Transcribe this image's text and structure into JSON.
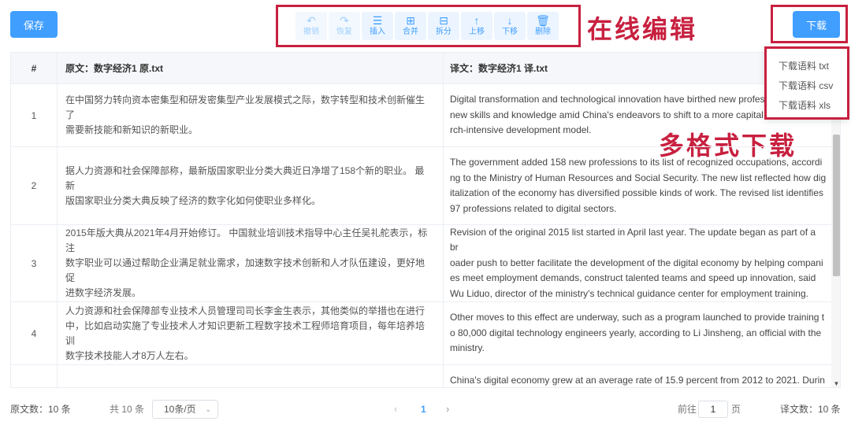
{
  "toolbar": {
    "save_label": "保存",
    "tools": [
      {
        "icon": "undo-icon",
        "glyph": "↶",
        "label": "撤销",
        "enabled": false
      },
      {
        "icon": "redo-icon",
        "glyph": "↷",
        "label": "恢复",
        "enabled": false
      },
      {
        "icon": "insert-icon",
        "glyph": "☰",
        "label": "插入",
        "enabled": true
      },
      {
        "icon": "merge-icon",
        "glyph": "⊞",
        "label": "合并",
        "enabled": true
      },
      {
        "icon": "split-icon",
        "glyph": "⊟",
        "label": "拆分",
        "enabled": true
      },
      {
        "icon": "arrow-up-icon",
        "glyph": "↑",
        "label": "上移",
        "enabled": true
      },
      {
        "icon": "arrow-down-icon",
        "glyph": "↓",
        "label": "下移",
        "enabled": true
      },
      {
        "icon": "trash-icon",
        "glyph": "🗑",
        "label": "删除",
        "enabled": true
      }
    ],
    "edit_callout": "在线编辑",
    "download_label": "下载",
    "download_options": [
      "下载语料 txt",
      "下载语料 csv",
      "下载语料 xls"
    ],
    "format_callout": "多格式下载"
  },
  "table": {
    "headers": {
      "num": "#",
      "source": "原文：数字经济1 原.txt",
      "target": "译文：数字经济1 译.txt"
    },
    "rows": [
      {
        "num": "1",
        "source": [
          "在中国努力转向资本密集型和研发密集型产业发展模式之际，数字转型和技术创新催生了",
          "需要新技能和新知识的新职业。"
        ],
        "target": [
          "Digital transformation and technological innovation have birthed new profess",
          "new skills and knowledge amid China's endeavors to shift to a more capital a",
          "rch-intensive development model."
        ]
      },
      {
        "num": "2",
        "source": [
          "据人力资源和社会保障部称，最新版国家职业分类大典近日净增了158个新的职业。 最新",
          "版国家职业分类大典反映了经济的数字化如何使职业多样化。"
        ],
        "target": [
          "The government added 158 new professions to its list of recognized occupations, accordi",
          "ng to the Ministry of Human Resources and Social Security. The new list reflected how dig",
          "italization of the economy has diversified possible kinds of work. The revised list identifies",
          "97 professions related to digital sectors."
        ]
      },
      {
        "num": "3",
        "source": [
          "2015年版大典从2021年4月开始修订。 中国就业培训技术指导中心主任吴礼舵表示，标注",
          "数字职业可以通过帮助企业满足就业需求，加速数字技术创新和人才队伍建设，更好地促",
          "进数字经济发展。"
        ],
        "target": [
          "Revision of the original 2015 list started in April last year. The update began as part of a br",
          "oader push to better facilitate the development of the digital economy by helping compani",
          "es meet employment demands, construct talented teams and speed up innovation, said",
          "Wu Liduo, director of the ministry's technical guidance center for employment training."
        ]
      },
      {
        "num": "4",
        "source": [
          "人力资源和社会保障部专业技术人员管理司司长李金生表示，其他类似的举措也在进行",
          "中，比如启动实施了专业技术人才知识更新工程数字技术工程师培育项目，每年培养培训",
          "数字技术技能人才8万人左右。"
        ],
        "target": [
          "Other moves to this effect are underway, such as a program launched to provide training t",
          "o 80,000 digital technology engineers yearly, according to Li Jinsheng, an official with the",
          "ministry."
        ]
      },
      {
        "num": "",
        "source": [],
        "target": [
          "China's digital economy grew at an average rate of 15.9 percent from 2012 to 2021. Durin"
        ]
      }
    ]
  },
  "footer": {
    "source_count": "原文数：10 条",
    "total": "共 10 条",
    "page_size": "10条/页",
    "prev": "‹",
    "current_page": "1",
    "next": "›",
    "goto_prefix": "前往",
    "goto_value": "1",
    "goto_suffix": "页",
    "target_count": "译文数：10 条"
  },
  "colors": {
    "accent": "#409eff",
    "highlight": "#c8203f"
  }
}
